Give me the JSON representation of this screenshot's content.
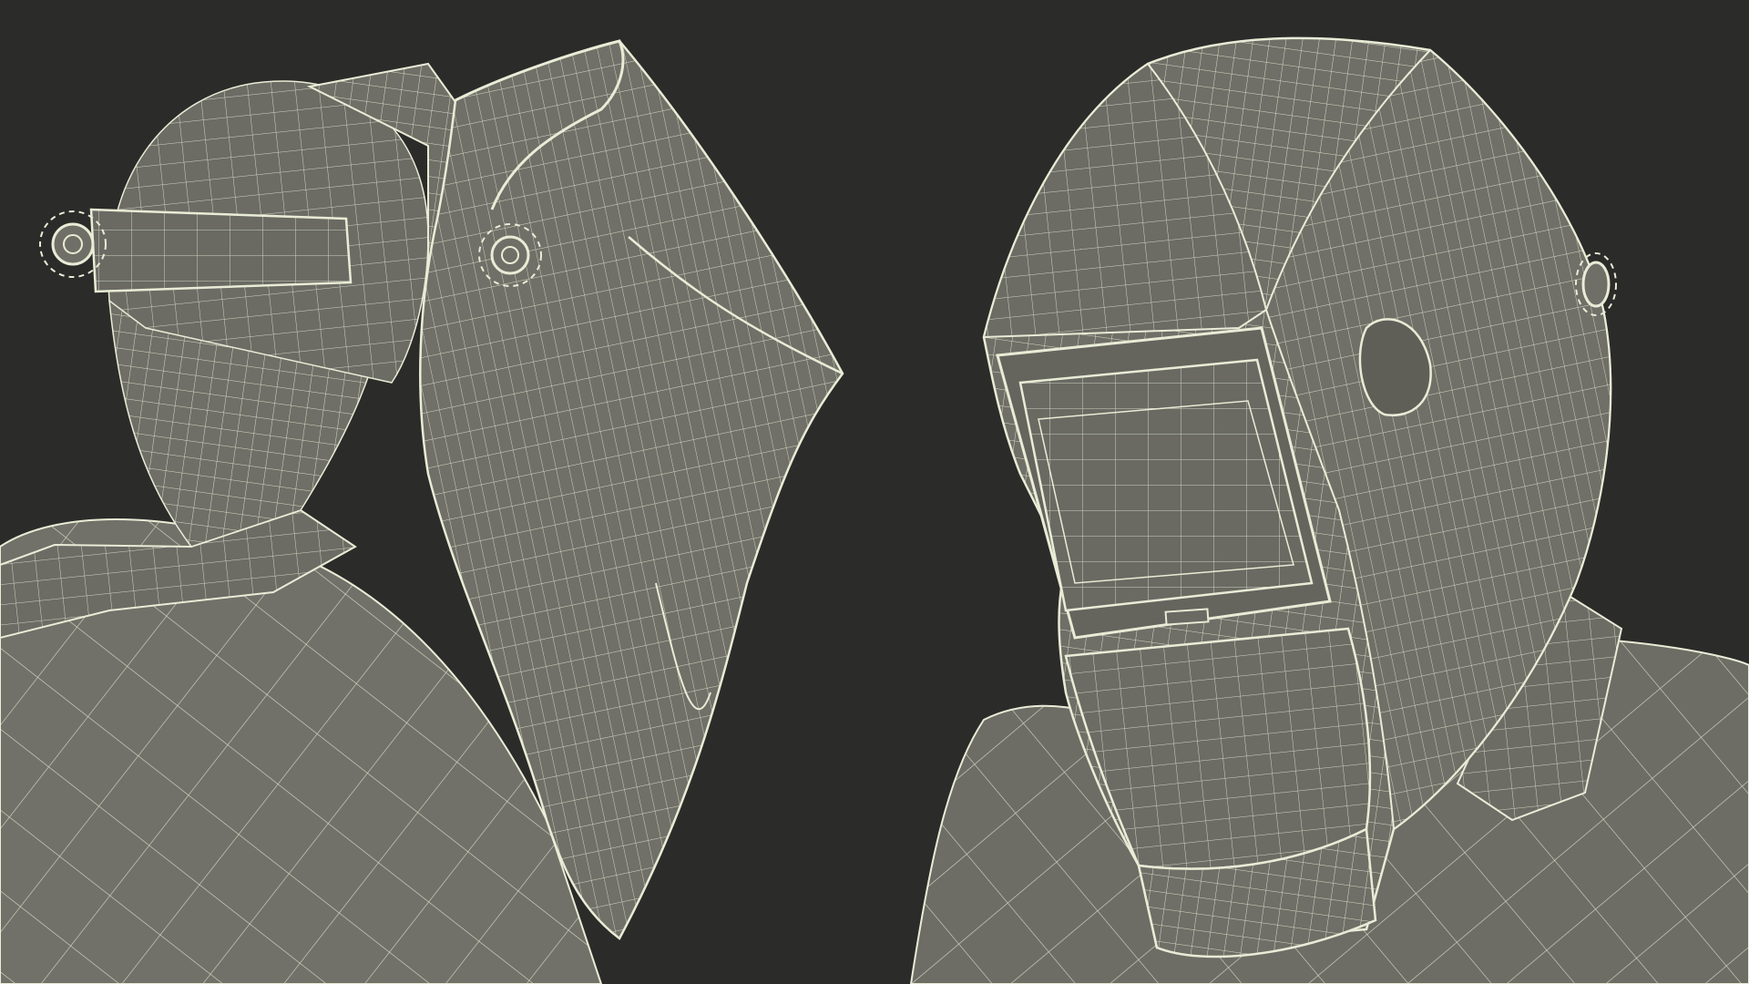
{
  "scene": {
    "background_color": "#2b2b29",
    "mesh_fill_color": "#6f6f67",
    "mesh_shadow_color": "#5c5c55",
    "wire_color": "#e9ecd6",
    "views": [
      {
        "id": "left",
        "subject": "welder-helmet-rear-three-quarter-view"
      },
      {
        "id": "right",
        "subject": "welder-helmet-front-three-quarter-view"
      }
    ]
  }
}
